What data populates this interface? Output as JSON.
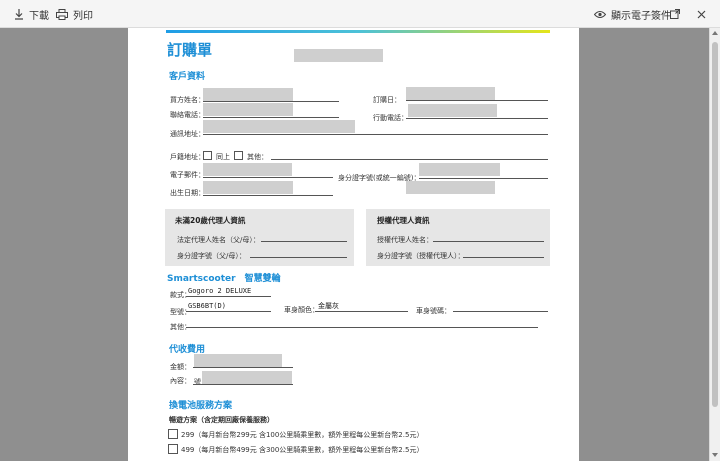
{
  "toolbar": {
    "download_label": "下載",
    "print_label": "列印",
    "show_signature_label": "顯示電子簽件"
  },
  "form": {
    "title": "訂購單",
    "customer_section": "客戶資料",
    "buyer_name_label": "買方姓名：",
    "order_date_label": "訂購日：",
    "phone_label": "聯絡電話：",
    "mobile_label": "行動電話：",
    "address_label": "通訊地址：",
    "household_label": "戶籍地址：",
    "same_as_label": "同上",
    "other_label": "其他：",
    "email_label": "電子郵件：",
    "id_label": "身分證字號(或統一編號)：",
    "birth_label": "出生日期：",
    "guardian_title": "未滿20歲代理人資訊",
    "guardian_name_label": "法定代理人姓名（父/母）：",
    "guardian_id_label": "身分證字號（父/母）：",
    "agent_title": "授權代理人資訊",
    "agent_name_label": "授權代理人姓名：",
    "agent_id_label": "身分證字號（授權代理人）：",
    "vehicle_section": "Smartscooter　智慧雙輪",
    "model_label": "款式：",
    "model_value": "Gogoro 2 DELUXE",
    "type_label": "型號：",
    "type_value": "GSB6BT(D)",
    "color_label": "車身顏色：",
    "color_value": "金屬灰",
    "frame_label": "車身號碼：",
    "other2_label": "其他：",
    "payment_section": "代收費用",
    "amount_label": "金額：",
    "content_label": "內容：",
    "content_value_prefix": "號",
    "battery_section": "換電池服務方案",
    "plans_title": "暢遊方案（含定期回廠保養服務）",
    "plans": [
      "299（每月新台幣299元 含100公里騎乘里數，額外里程每公里新台幣2.5元）",
      "499（每月新台幣499元 含300公里騎乘里數，額外里程每公里新台幣2.5元）"
    ]
  }
}
